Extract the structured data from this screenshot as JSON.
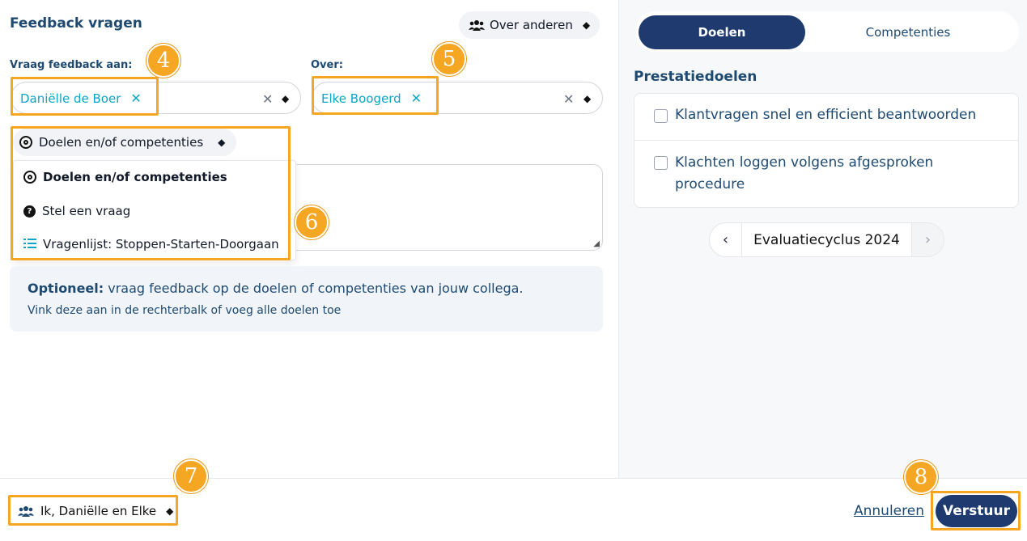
{
  "header": {
    "title": "Feedback vragen",
    "mode_select": "Over anderen"
  },
  "form": {
    "ask_label": "Vraag feedback aan:",
    "ask_chip": "Daniëlle de Boer",
    "about_label": "Over:",
    "about_chip": "Elke Boogerd",
    "type_select": "Doelen en/of competenties",
    "dropdown": [
      "Doelen en/of competenties",
      "Stel een vraag",
      "Vragenlijst: Stoppen-Starten-Doorgaan"
    ],
    "info_bold": "Optioneel:",
    "info_text": " vraag feedback op de doelen of competenties van jouw collega.",
    "info_sub": "Vink deze aan in de rechterbalk of voeg alle doelen toe"
  },
  "sidebar": {
    "tab_active": "Doelen",
    "tab_inactive": "Competenties",
    "section_title": "Prestatiedoelen",
    "goals": [
      "Klantvragen snel en efficient beantwoorden",
      "Klachten loggen volgens afgesproken procedure"
    ],
    "cycle": "Evaluatiecyclus 2024"
  },
  "footer": {
    "visibility": "Ik, Daniëlle en Elke",
    "cancel": "Annuleren",
    "send": "Verstuur"
  },
  "badges": [
    "4",
    "5",
    "6",
    "7",
    "8"
  ],
  "colors": {
    "primary": "#1e3a6e",
    "accent": "#0ea5c6",
    "highlight": "#f5a623",
    "text": "#1e4a72"
  }
}
